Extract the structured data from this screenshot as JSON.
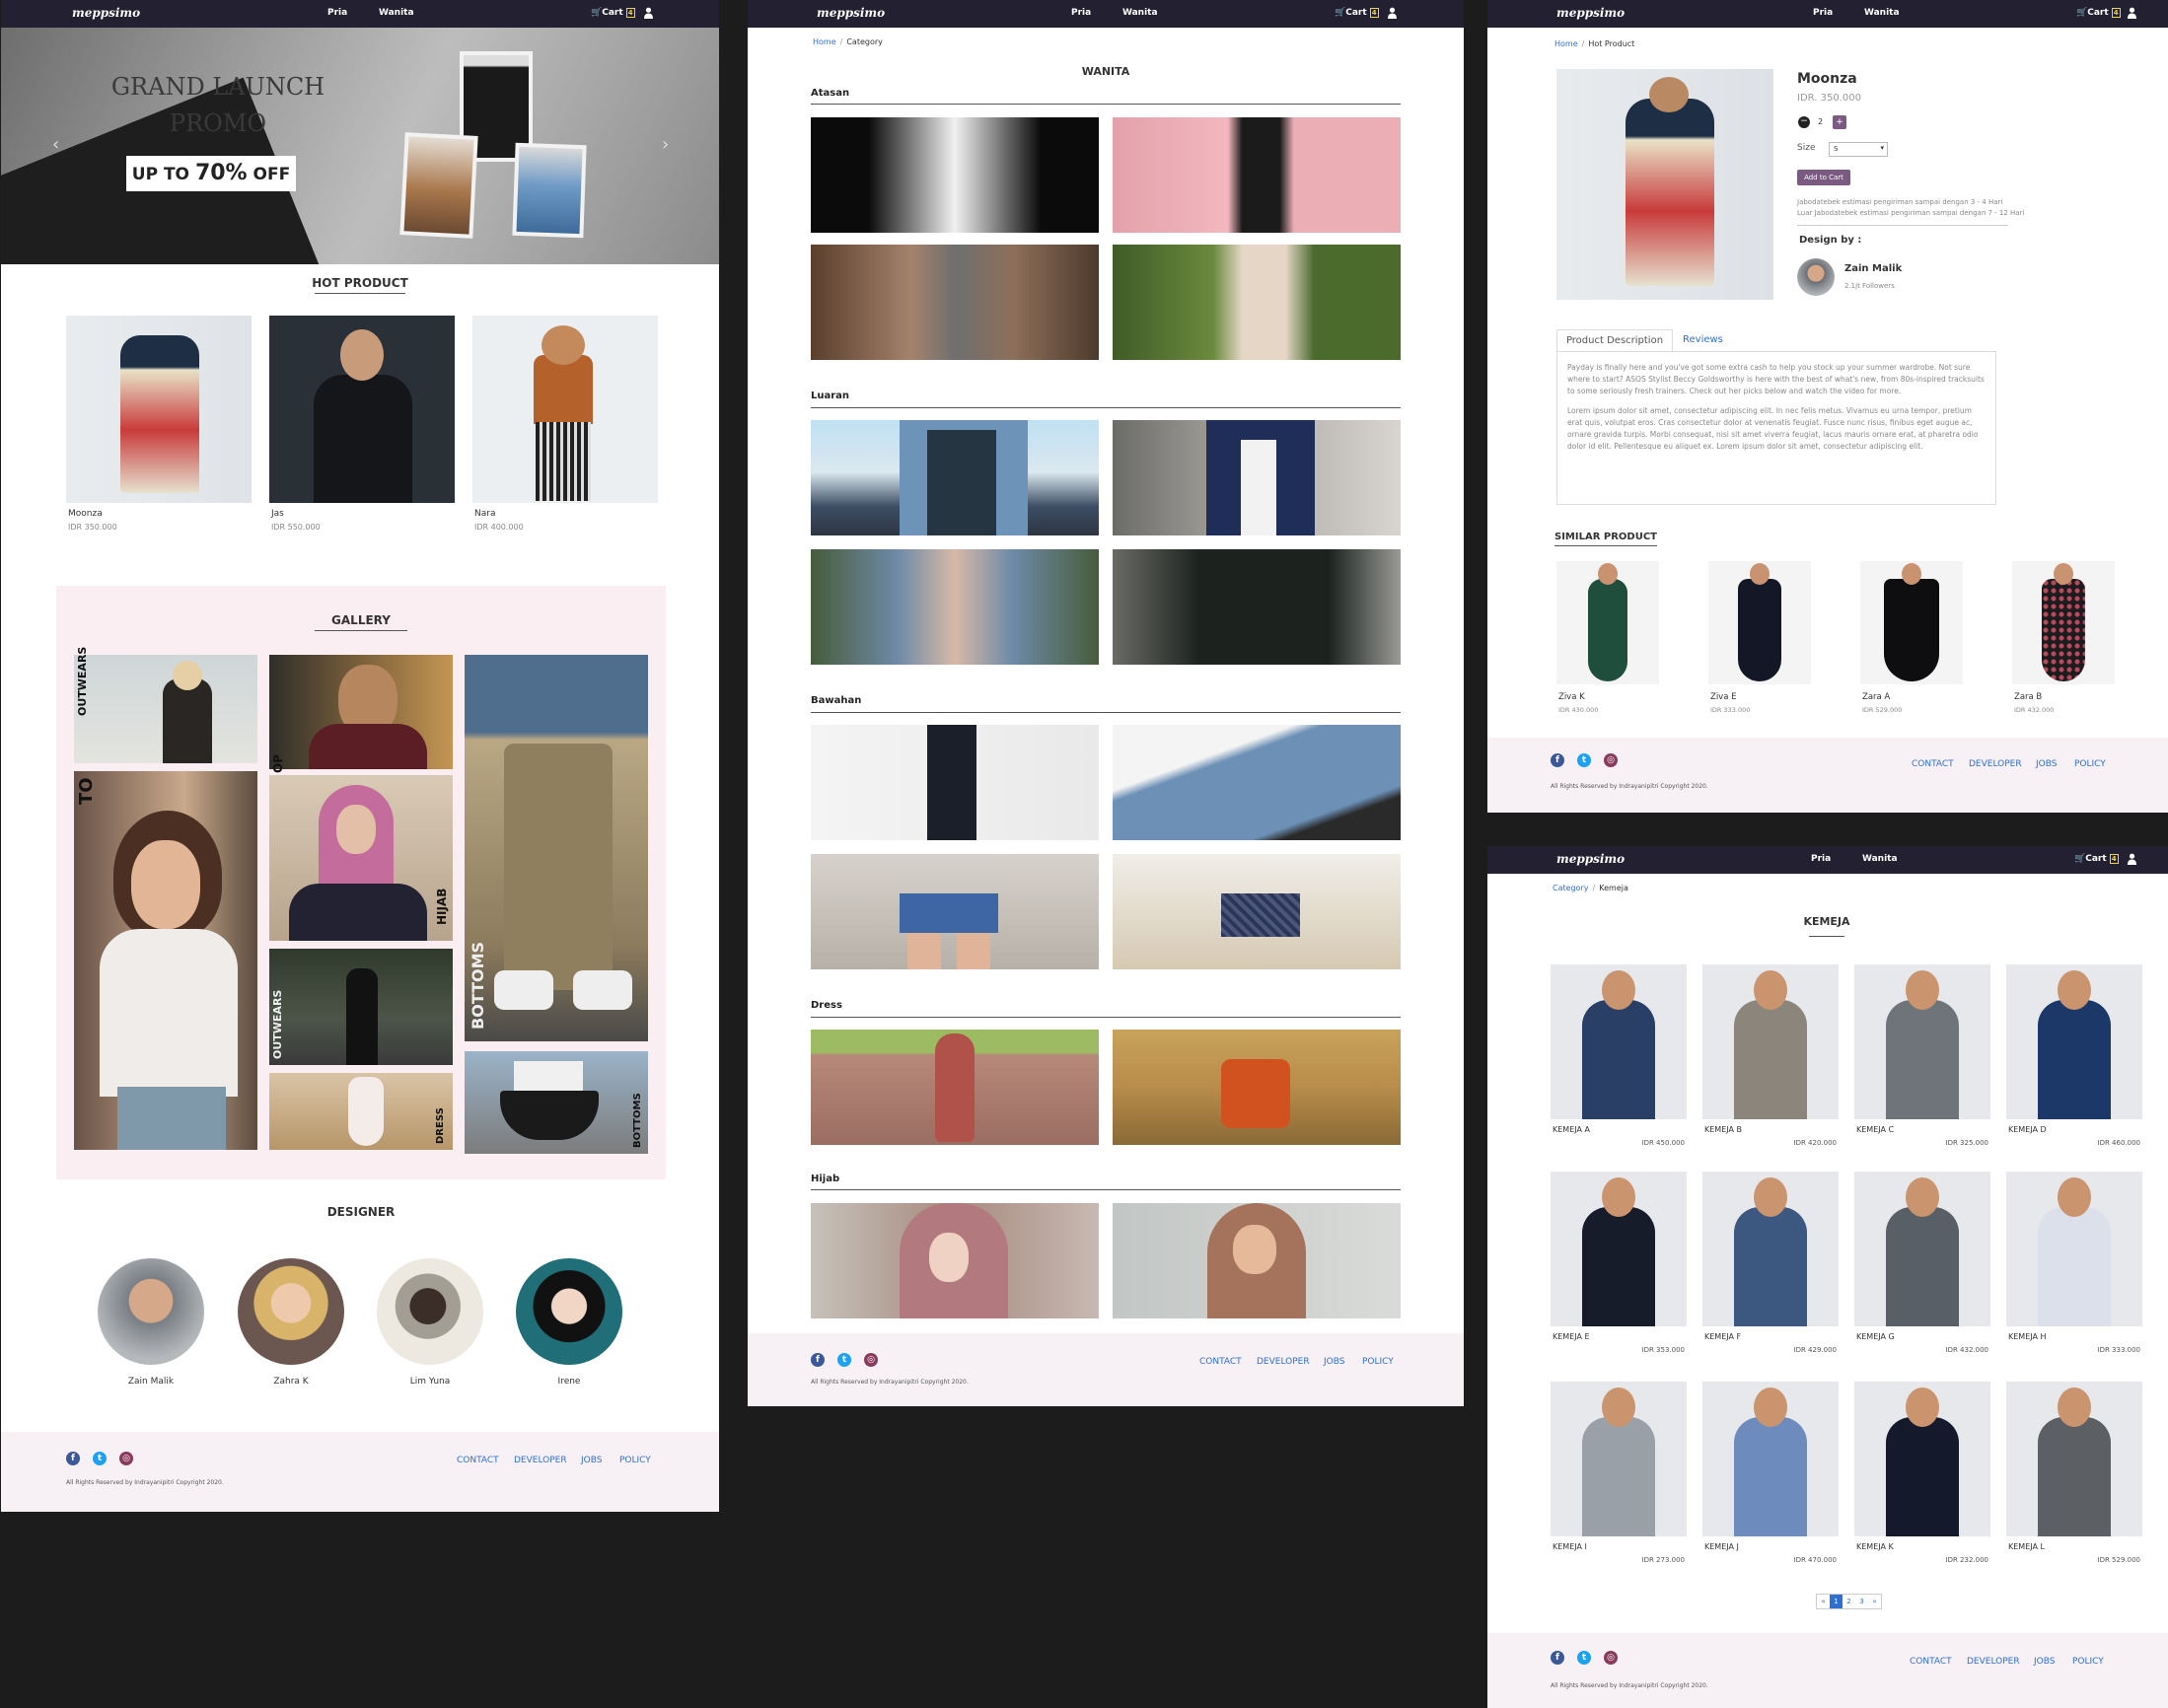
{
  "brand": "meppsimo",
  "nav": {
    "pria": "Pria",
    "wanita": "Wanita",
    "cart": "Cart",
    "cart_count": "4"
  },
  "footer": {
    "links": [
      "CONTACT",
      "DEVELOPER",
      "JOBS",
      "POLICY"
    ],
    "copyright": "All Rights Reserved by Indrayanipitri Copyright 2020."
  },
  "home": {
    "banner": {
      "title1": "GRAND LAUNCH",
      "title2": "PROMO",
      "promo_pre": "UP TO ",
      "promo_pct": "70%",
      "promo_post": " OFF"
    },
    "hot_title": "HOT PRODUCT",
    "hot": [
      {
        "name": "Moonza",
        "price": "IDR 350.000"
      },
      {
        "name": "Jas",
        "price": "IDR 550.000"
      },
      {
        "name": "Nara",
        "price": "IDR 400.000"
      }
    ],
    "gallery_title": "GALLERY",
    "gallery_labels": {
      "outwears": "OUTWEARS",
      "top": "TO",
      "top2": "OP",
      "hijab": "HIJAB",
      "outwears2": "OUTWEARS",
      "bottoms": "BOTTOMS",
      "dress": "DRESS",
      "bottoms2": "BOTTOMS"
    },
    "designer_title": "DESIGNER",
    "designers": [
      "Zain Malik",
      "Zahra K",
      "Lim Yuna",
      "Irene"
    ]
  },
  "category": {
    "breadcrumb": {
      "home": "Home",
      "current": "Category"
    },
    "title": "WANITA",
    "sections": [
      "Atasan",
      "Luaran",
      "Bawahan",
      "Dress",
      "Hijab"
    ]
  },
  "detail": {
    "breadcrumb": {
      "home": "Home",
      "current": "Hot Product"
    },
    "name": "Moonza",
    "price": "IDR. 350.000",
    "qty": "2",
    "size_label": "Size",
    "size_value": "S",
    "add_to_cart": "Add to Cart",
    "ship1": "Jabodatebek estimasi pengiriman sampai dengan 3 - 4 Hari",
    "ship2": "Luar Jabodatebek estimasi pengiriman sampai dengan 7 - 12 Hari",
    "design_by": "Design by :",
    "designer": "Zain Malik",
    "followers": "2.1jt Followers",
    "tabs": [
      "Product Description",
      "Reviews"
    ],
    "desc1": "Payday is finally here and you've got some extra cash to help you stock up your summer wardrobe. Not sure where to start? ASOS Stylist Beccy Goldsworthy is here with the best of what's new, from 80s-inspired tracksuits to some seriously fresh trainers. Check out her picks below and watch the video for more.",
    "desc2": "Lorem ipsum dolor sit amet, consectetur adipiscing elit. In nec felis metus. Vivamus eu urna tempor, pretium erat quis, volutpat eros. Cras consectetur dolor at venenatis feugiat. Fusce nunc risus, finibus eget augue ac, ornare gravida turpis. Morbi consequat, nisi sit amet viverra feugiat, lacus mauris ornare erat, at pharetra odio dolor id elit. Pellentesque eu aliquet ex. Lorem ipsum dolor sit amet, consectetur adipiscing elit.",
    "similar_title": "SIMILAR PRODUCT",
    "similar": [
      {
        "name": "Ziva K",
        "price": "IDR 430.000"
      },
      {
        "name": "Ziva E",
        "price": "IDR 333.000"
      },
      {
        "name": "Zara A",
        "price": "IDR 529.000"
      },
      {
        "name": "Zara B",
        "price": "IDR 432.000"
      }
    ]
  },
  "kemeja": {
    "breadcrumb": {
      "home": "Category",
      "current": "Kemeja"
    },
    "title": "KEMEJA",
    "items": [
      {
        "name": "KEMEJA A",
        "price": "IDR 450.000"
      },
      {
        "name": "KEMEJA B",
        "price": "IDR 420.000"
      },
      {
        "name": "KEMEJA C",
        "price": "IDR 325.000"
      },
      {
        "name": "KEMEJA D",
        "price": "IDR 460.000"
      },
      {
        "name": "KEMEJA E",
        "price": "IDR 353.000"
      },
      {
        "name": "KEMEJA F",
        "price": "IDR 429.000"
      },
      {
        "name": "KEMEJA G",
        "price": "IDR 432.000"
      },
      {
        "name": "KEMEJA H",
        "price": "IDR 333.000"
      },
      {
        "name": "KEMEJA I",
        "price": "IDR 273.000"
      },
      {
        "name": "KEMEJA J",
        "price": "IDR 470.000"
      },
      {
        "name": "KEMEJA K",
        "price": "IDR 232.000"
      },
      {
        "name": "KEMEJA L",
        "price": "IDR 529.000"
      }
    ],
    "pagination": [
      "«",
      "1",
      "2",
      "3",
      "»"
    ]
  },
  "colors": {
    "nav": "#232131",
    "footer": "#f7f1f6",
    "link": "#2f6fd1",
    "accent": "#7a5a80",
    "gallery_bg": "#fbeef3"
  }
}
